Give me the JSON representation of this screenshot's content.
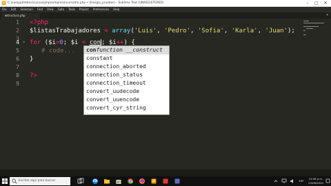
{
  "window": {
    "title": "C:\\xampp\\htdocs\\cursos\\php\\rempresa\\curso\\for.php • (Inergia_pruebas) - Sublime Text (UNREGISTERED)",
    "minimize_icon": "minimize-icon",
    "maximize_icon": "maximize-icon",
    "close_icon": "close-icon"
  },
  "menu": [
    "File",
    "Edit",
    "Selection",
    "Find",
    "View",
    "Goto",
    "Tools",
    "Project",
    "Preferences",
    "Help"
  ],
  "tab": {
    "label": "estructura.php",
    "close": "×"
  },
  "gutter": {
    "lines": [
      "1",
      "2",
      "3",
      "4",
      "5",
      "6",
      "7",
      "8",
      "9"
    ],
    "current_line": "4"
  },
  "code": {
    "line1": "<?php",
    "line2_var": "$listasTrabajadores",
    "line2_eq": " = ",
    "line2_fn": "array",
    "line2_open": "(",
    "line2_s1": "'Luis'",
    "line2_s2": "'Pedro'",
    "line2_s3": "'Sofia'",
    "line2_s4": "'Karla'",
    "line2_s5": "'Juan'",
    "line2_close": ");",
    "sep": ", ",
    "line4_kw": "for",
    "line4_a": " ($i",
    "line4_eq": "=",
    "line4_zero": "0",
    "line4_b": "; $i ",
    "line4_lt": "<",
    "line4_typed": "con",
    "line4_c": "; $i",
    "line4_inc": "++",
    "line4_d": ") {",
    "line5_comment": "# code...",
    "line6": "}",
    "line8": "?>"
  },
  "autocomplete": {
    "items": [
      {
        "match": "con",
        "rest": "function __construct",
        "italic": true
      },
      {
        "match": "",
        "rest": "constant",
        "italic": false
      },
      {
        "match": "",
        "rest": "connection_aborted",
        "italic": false
      },
      {
        "match": "",
        "rest": "connection_status",
        "italic": false
      },
      {
        "match": "",
        "rest": "connection_timeout",
        "italic": false
      },
      {
        "match": "",
        "rest": "convert_uudecode",
        "italic": false
      },
      {
        "match": "",
        "rest": "convert_uuencode",
        "italic": false
      },
      {
        "match": "",
        "rest": "convert_cyr_string",
        "italic": false
      }
    ]
  },
  "taskbar": {
    "search_placeholder": "Escribe aquí para buscar",
    "time": "15:08 p.m.",
    "date": "25/08/2020",
    "lang": "ESP"
  },
  "colors": {
    "editor_bg": "#272822",
    "keyword": "#f92672",
    "function": "#66d9ef",
    "string": "#e6db74",
    "number": "#ae81ff",
    "comment": "#75715e"
  }
}
